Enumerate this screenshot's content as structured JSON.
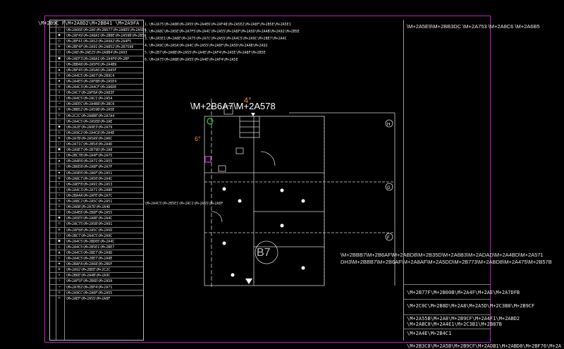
{
  "legend": {
    "header": "\\M+2B9C F\\M+2A8D2\\M+2BB41 \\M+2A9FA",
    "rows": [
      "\\M+2A66E\\M+2A6\\M+2B677\\M+2A8D5\\M+2A5E4",
      "\\M+2AF49\\M+2A8A1\\M+2BBE\\M+2A59B\\M+2B5A",
      "\\M+2BF41\\M+2A52\\M+2A9A2\\M+2A4F5",
      "\\M+2BF4F\\M+2A91\\M+2A852\\M+2B7596",
      "\\M+2A8\\M+2AE25\\M+2A8B4\\M+2A93",
      "\\M+2AEF3\\M+2A8A1\\M+2A4F0\\M+2BF",
      "\\M+2BB48\\M+2A5F6\\M+2A4B9",
      "\\M+2BF45\\M+2A5A6\\M+2AA5F",
      "\\M+2A4C5\\M+2A67\\M+2B9C4",
      "\\M+2A4E5\\M+2AF8B\\M+2A5E4",
      "\\M+2A4C3\\M+2A4CF\\M+2A6DE",
      "\\M+2AC7\\M+2AF0A\\M+2A83F",
      "\\M+2A4C5\\M+2AC1\\M+2A54",
      "\\M+2AEEC\\M+2A4B8\\M+2BC0",
      "\\M+2BB52\\M+2A59B\\M+2A5E",
      "\\M+2C2C\\M+2A8BE\\M+2A7A4",
      "\\M+2A4C5\\M+2A5EB\\M+2AE",
      "\\M+2A2E\\M+2A9E3\\M+2A79",
      "\\M+2A9C2\\M+2A4C8\\M+2A4E",
      "\\M+2A7B\\M+2A5A9\\M+2A6C",
      "\\M+2A71C\\M+2B54\\M+2A4D",
      "\\M+2A9E7\\M+2B79D\\M+2A8",
      "\\M+2BC7B\\M+2A4F\\M+2A75",
      "\\M+2A4E8\\M+2A71\\M+2A55",
      "\\M+2B6E8\\M+2A8F\\M+2A7F",
      "\\M+2A9E0\\M+2A6F\\M+2A51",
      "\\M+2A8C7\\M+2A50\\M+2A4C",
      "\\M+2AEF8\\M+2A91\\M+2A53",
      "\\M+2A4C3\\M+2A71\\M+2A80",
      "\\M+2BA4A\\M+2AFE\\M+2A7C",
      "\\M+2A8C2\\M+2A5C\\M+2A51",
      "\\M+2A6B\\M+2A7D\\M+2A4D",
      "\\M+2A4E6\\M+2B8F\\M+2A55",
      "\\M+2A5E5\\M+2A8E\\M+2A4C",
      "\\M+2AC75\\M+2A5B\\M+2A91",
      "\\M+2AF88\\M+2A5C\\M+2A5D",
      "\\M+2BC7\\M+2A4C5\\M+2A9C",
      "\\M+2A4C5\\M+2BD05\\M+2A4C",
      "\\M+2A4C5\\M+2B5E1\\M+2BE7",
      "\\M+2A4C5\\M+2BE7\\M+2A9D",
      "\\M+2A4C5\\M+2BE7\\M+2A9E",
      "\\M+2BAFA\\M+2A68\\M+2B6F",
      "\\M+2A92\\M+2BEE\\M+2C2C",
      "\\M+2B6E\\M+2A4B\\M+2A9C",
      "\\M+2AF5F\\M+2B6D\\M+2A5A",
      "\\M+2A7B2\\M+2BF4\\M+2A71",
      "\\M+2A9CC\\M+2A8F\\M+2A55",
      "\\M+2AEF\\M+2A55\\M+2A8F"
    ]
  },
  "notes": {
    "lines": [
      "1.\\M+2A75\\M+2A8B\\M+2A55\\M+2A4E6\\M+2AF48\\M+2A5E2\\M+2A8F\\M+2B5E\\M+2A5E1",
      "2.\\M+2A8C\\M+2A5E\\M+2A7F5\\M+2A4C\\M+2A55\\M+2A8F\\M+2A5D\\M+2A4B\\M+2A92\\M+2B5E",
      "3.\\M+2A5E1\\M+2A8E\\M+2A75\\M+2A7C\\M+2A55\\M+2A4C5\\M+2A9C\\M+2BE7\\M+2A4C",
      "4.\\M+2A9C\\M+2A5A\\M+2A4C\\M+2A55\\M+2A8F\\M+2A5D\\M+2A4B\\M+2A92",
      "5.\\M+2B7\\M+2A8B\\M+2A55\\M+2A4E\\M+2AF4\\M+2A5E\\M+2A8F\\M+2B5E",
      "6.\\M+2A75\\M+2A8B\\M+2A55\\M+2A4E\\M+2AF4\\M+2A5E"
    ]
  },
  "plan": {
    "title": "\\M+2B6A7\\M+2A578",
    "room_label": "B7",
    "marker_4": "4°",
    "marker_6": "6°",
    "grid_h": "H",
    "grid_g": "G",
    "grid_f": "F",
    "notes_mid": "\\M+2A4C5\\M+2B5E1\\M+2AC1\\M+2A55\\M+2A8F",
    "dh_line1": "\\M+2BBB7\\M+2B6AF\\M+2ABD8\\M+2B35D\\M+2A6B3\\M+2ADAD\\M+2A4BD\\M+2A571",
    "dh_line2": "DH3\\M+2BBB7\\M+2B6AF\\M+2A8AF\\M+2A5DD\\M+2B773\\M+2ABD8\\M+2A475\\M+2B57B"
  },
  "titleblock": {
    "top": "\\M+2A5E9\\M+2BB3DC \\M+2A753 \\M+2A8C6 \\M+2A6B5",
    "rows": [
      "\\M+2B77F\\M+2B00B\\M+2A4F\\M+2AE\\M+2A7DFB",
      "\\M+2C0C\\M+2B8D\\M+2A8\\M+2A5D\\M+2C3B8\\M+2B9CF",
      "\\M+2A55B\\M+2A8\\M+2B9CF\\M+2A4F1\\M+2ABD2",
      "\\M+2ABC8\\M+2A4E1\\M+2C3B1\\M+2B87B",
      "\\M+2A4E\\M+2B4C1",
      "\\M+2B3C8\\M+2A5B\\M+2B9CF\\M+2ADB1\\M+2ABD8\\M+2BF76\\M+2A"
    ]
  },
  "colors": {
    "frame": "#c020c0",
    "accent_orange": "#ff8a1e",
    "accent_green": "#30d040",
    "accent_magenta": "#d040d0"
  }
}
